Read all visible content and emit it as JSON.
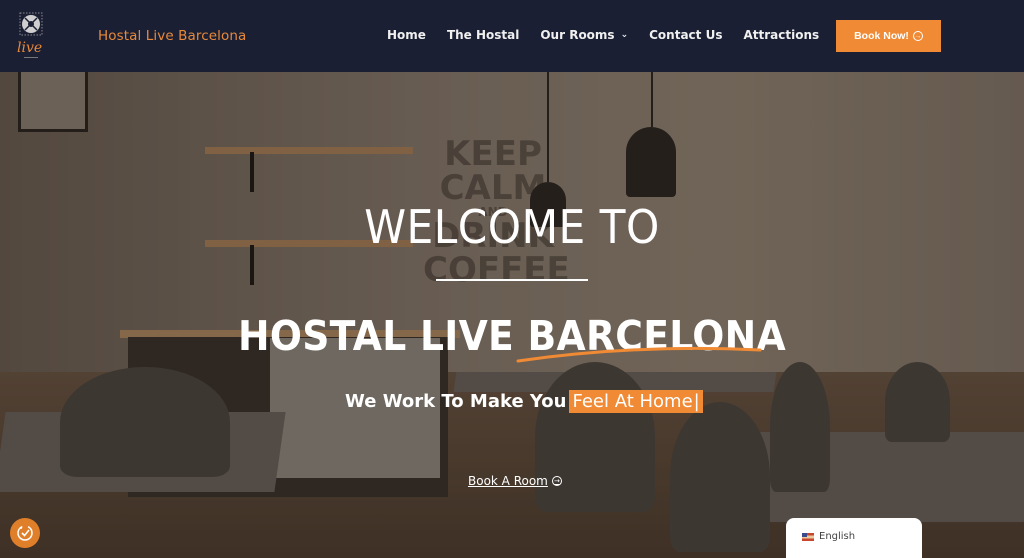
{
  "header": {
    "logo_text": "live",
    "brand": "Hostal Live Barcelona",
    "nav": [
      {
        "label": "Home"
      },
      {
        "label": "The Hostal"
      },
      {
        "label": "Our Rooms",
        "has_dropdown": true
      },
      {
        "label": "Contact Us"
      },
      {
        "label": "Attractions"
      }
    ],
    "book_button": "Book Now!"
  },
  "hero": {
    "wall_text": [
      "KEEP",
      "CALM",
      "AND",
      "DRINK",
      "COFFEE"
    ],
    "heading_line1": "WELCOME TO",
    "heading_line2": "HOSTAL LIVE BARCELONA",
    "tagline_static": "We Work To Make You",
    "tagline_typed": "Feel At Home",
    "tagline_cursor": "|",
    "cta": "Book A Room"
  },
  "widgets": {
    "accessibility_icon": "accessibility-icon",
    "language": "English"
  },
  "colors": {
    "header_bg": "#1b1f33",
    "accent": "#f08a34"
  }
}
